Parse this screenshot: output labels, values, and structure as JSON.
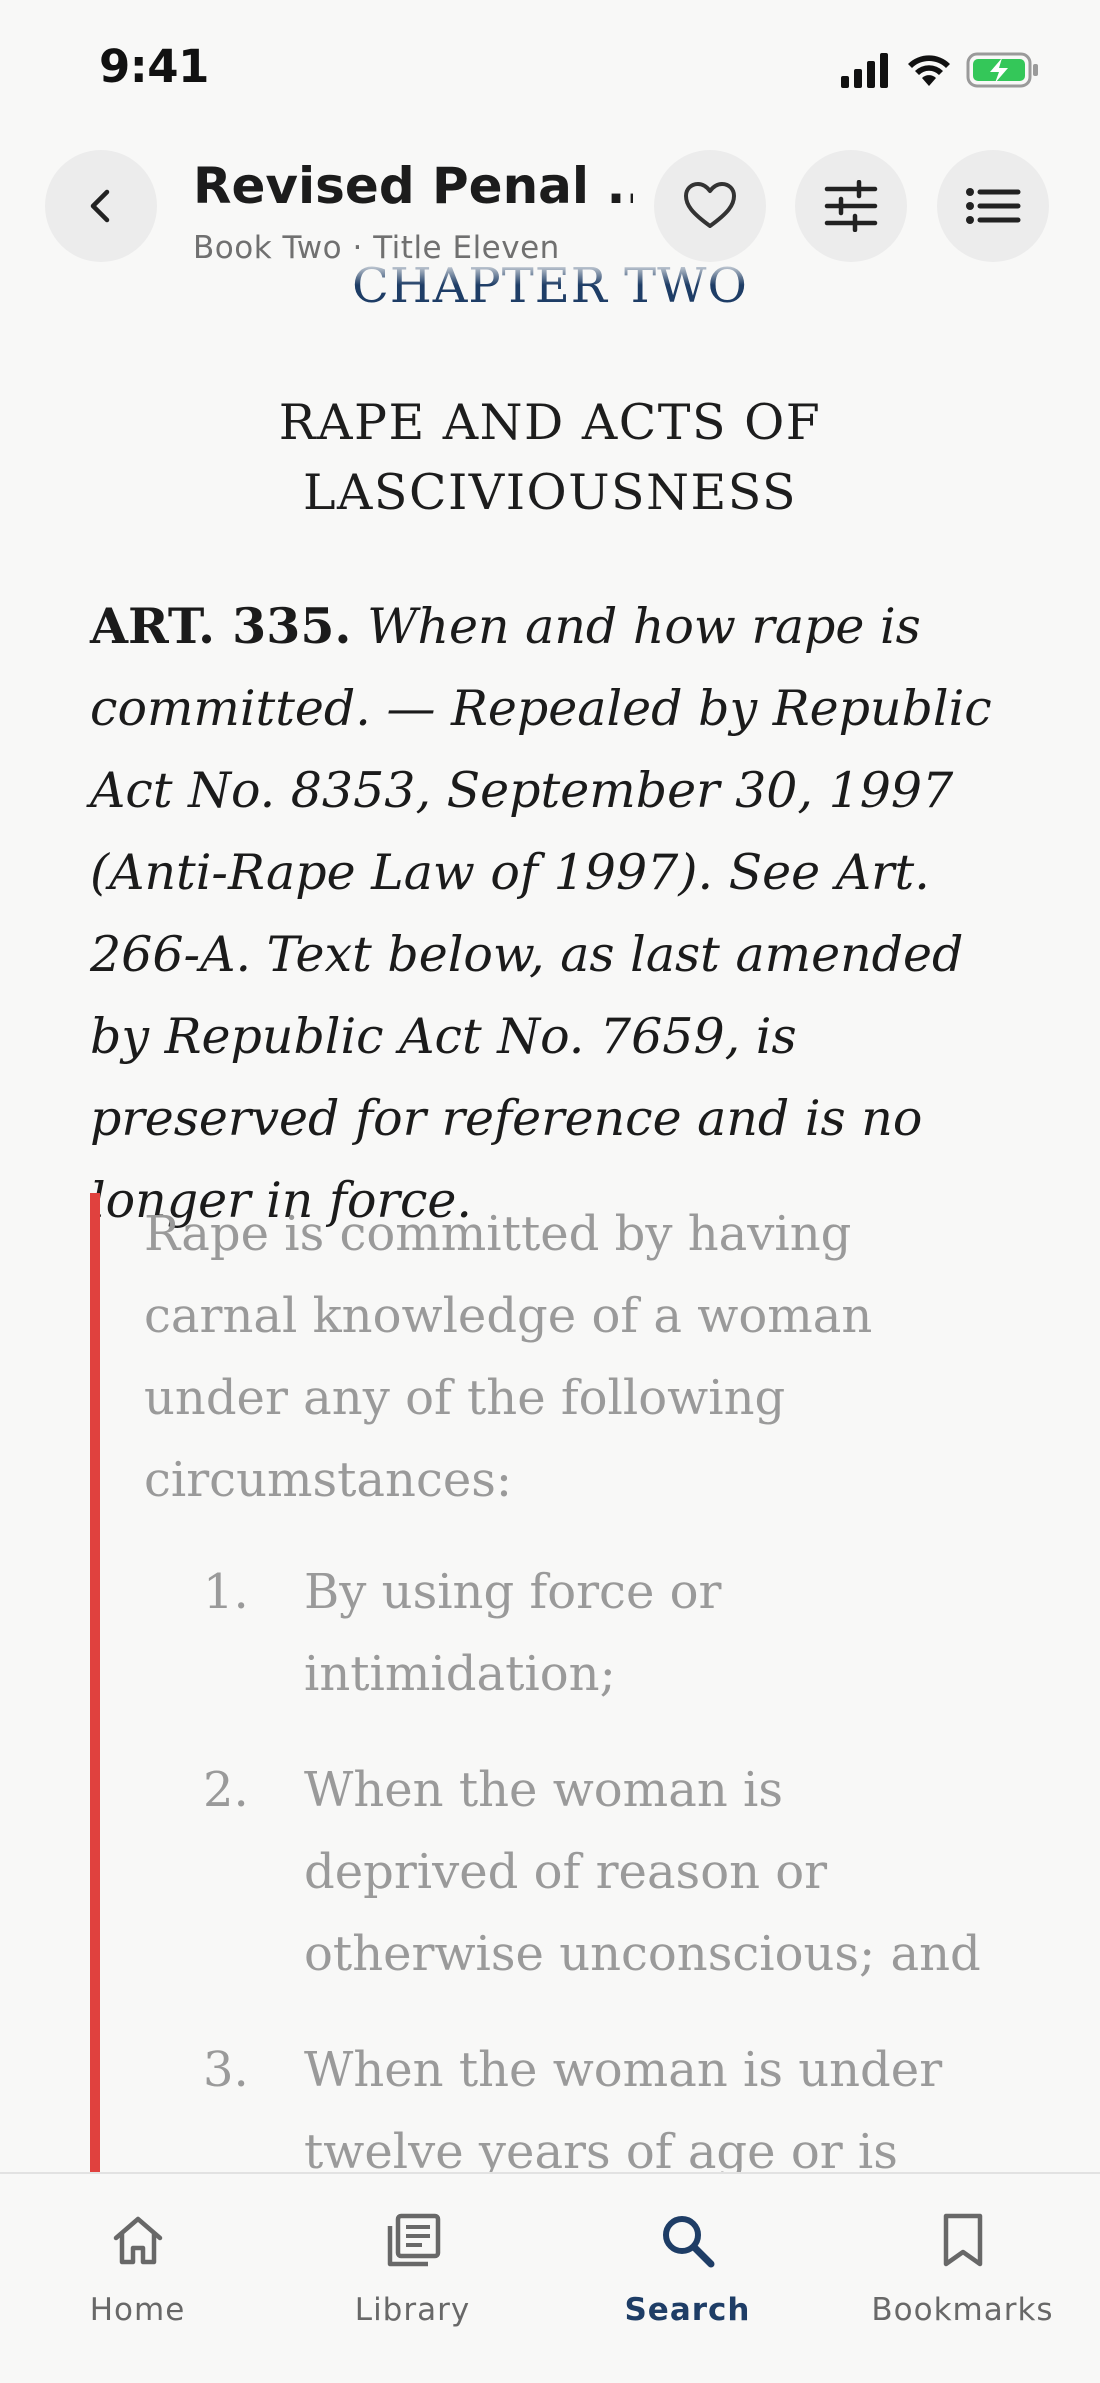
{
  "status_bar": {
    "time": "9:41"
  },
  "header": {
    "title": "Revised Penal ...",
    "subtitle": "Book Two · Title Eleven",
    "back_icon": "chevron-left-icon",
    "favorite_icon": "heart-icon",
    "settings_icon": "sliders-icon",
    "toc_icon": "list-icon"
  },
  "content": {
    "chapter_heading": "CHAPTER TWO",
    "chapter_title": "RAPE AND ACTS OF LASCIVIOUSNESS",
    "article_number": "ART. 335.",
    "article_text": "When and how rape is committed. — Repealed by Republic Act No. 8353, September 30, 1997 (Anti-Rape Law of 1997). See Art. 266-A. Text below, as last amended by Republic Act No. 7659, is preserved for reference and is no longer in force.",
    "quote_intro": "Rape is committed by having carnal knowledge of a woman under any of the following circumstances:",
    "quote_items": [
      {
        "num": "1.",
        "text": "By using force or intimidation;"
      },
      {
        "num": "2.",
        "text": "When the woman is deprived of reason or otherwise unconscious; and"
      },
      {
        "num": "3.",
        "text": "When the woman is under twelve years of age or is"
      }
    ]
  },
  "bottom_nav": {
    "items": [
      {
        "label": "Home",
        "icon": "home-icon"
      },
      {
        "label": "Library",
        "icon": "library-icon"
      },
      {
        "label": "Search",
        "icon": "search-icon",
        "active": true
      },
      {
        "label": "Bookmarks",
        "icon": "bookmark-icon"
      }
    ]
  },
  "colors": {
    "accent": "#1e3d66",
    "quote_bar": "#e0413e",
    "battery": "#34c759"
  }
}
